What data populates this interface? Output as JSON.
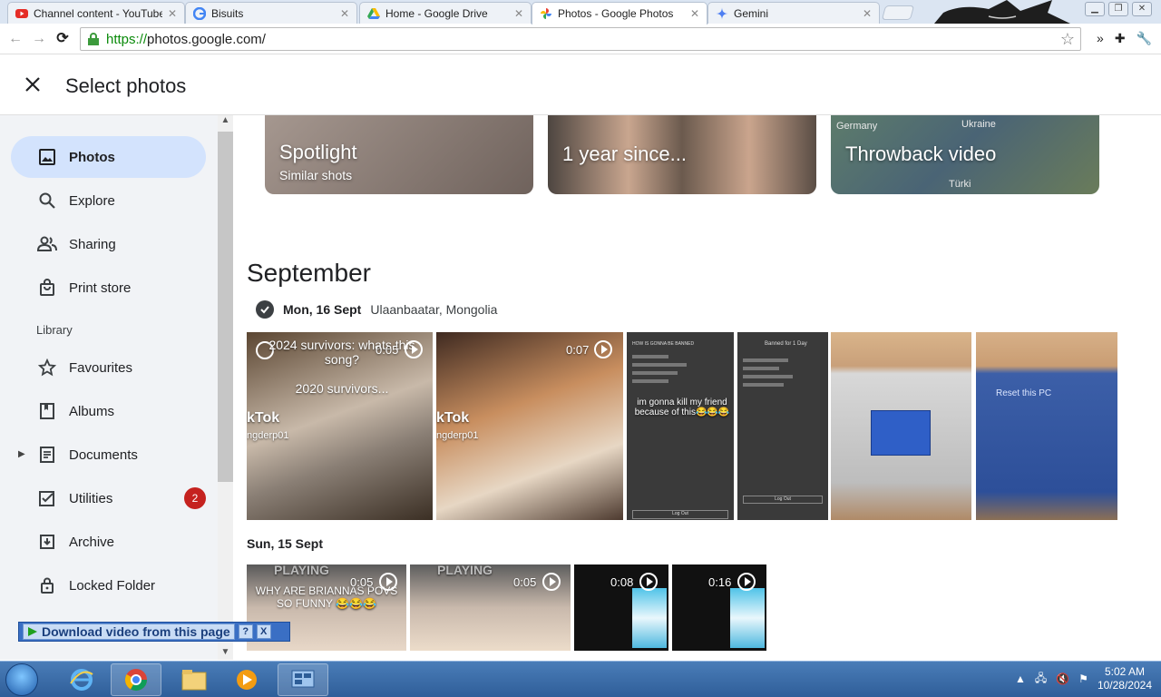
{
  "browser": {
    "tabs": [
      {
        "title": "Channel content - YouTube",
        "icon": "youtube-icon"
      },
      {
        "title": "Bisuits",
        "icon": "google-icon"
      },
      {
        "title": "Home - Google Drive",
        "icon": "drive-icon"
      },
      {
        "title": "Photos - Google Photos",
        "icon": "photos-icon",
        "active": true
      },
      {
        "title": "Gemini",
        "icon": "gemini-icon"
      }
    ],
    "url_scheme": "https://",
    "url_rest": "photos.google.com/"
  },
  "header": {
    "title": "Select photos",
    "close_icon": "close-icon"
  },
  "sidebar": {
    "items": [
      {
        "label": "Photos",
        "icon": "photos-icon",
        "active": true
      },
      {
        "label": "Explore",
        "icon": "search-icon"
      },
      {
        "label": "Sharing",
        "icon": "people-icon"
      },
      {
        "label": "Print store",
        "icon": "bag-icon"
      }
    ],
    "library_label": "Library",
    "library_items": [
      {
        "label": "Favourites",
        "icon": "star-icon"
      },
      {
        "label": "Albums",
        "icon": "album-icon"
      },
      {
        "label": "Documents",
        "icon": "document-icon"
      },
      {
        "label": "Utilities",
        "icon": "utilities-icon",
        "badge": "2"
      },
      {
        "label": "Archive",
        "icon": "archive-icon"
      },
      {
        "label": "Locked Folder",
        "icon": "lock-icon"
      }
    ]
  },
  "main": {
    "cards": [
      {
        "title": "Spotlight",
        "subtitle": "Similar shots"
      },
      {
        "title": "1 year since..."
      },
      {
        "title": "Throwback video",
        "map_labels": [
          "Germany",
          "Ukraine",
          "Türki"
        ]
      }
    ],
    "month": "September",
    "group1": {
      "date": "Mon, 16 Sept",
      "location": "Ulaanbaatar, Mongolia",
      "items": [
        {
          "duration": "0:05",
          "caption": "2024 survivors: whats this song?",
          "caption2": "2020 survivors...",
          "watermark": "kTok",
          "handle": "ngderp01"
        },
        {
          "duration": "0:07",
          "watermark": "kTok",
          "handle": "ngderp01"
        },
        {
          "header": "HOW IS GONNA BE BANNED",
          "caption": "im gonna kill my friend because of this😂😂😂",
          "footer": "Log Out"
        },
        {
          "header": "Banned for 1 Day",
          "footer": "Log Out"
        },
        {
          "type": "photo"
        },
        {
          "screen_text": "Reset this PC"
        }
      ]
    },
    "group2": {
      "date": "Sun, 15 Sept",
      "items": [
        {
          "duration": "0:05",
          "caption": "WHY ARE BRIANNAS POVS SO FUNNY 😂😂😂",
          "top": "PLAYING"
        },
        {
          "duration": "0:05",
          "top": "PLAYING"
        },
        {
          "duration": "0:08"
        },
        {
          "duration": "0:16"
        }
      ]
    }
  },
  "download_bar": {
    "label": "Download video from this page",
    "help": "?",
    "close": "X"
  },
  "taskbar": {
    "time": "5:02 AM",
    "date": "10/28/2024"
  }
}
